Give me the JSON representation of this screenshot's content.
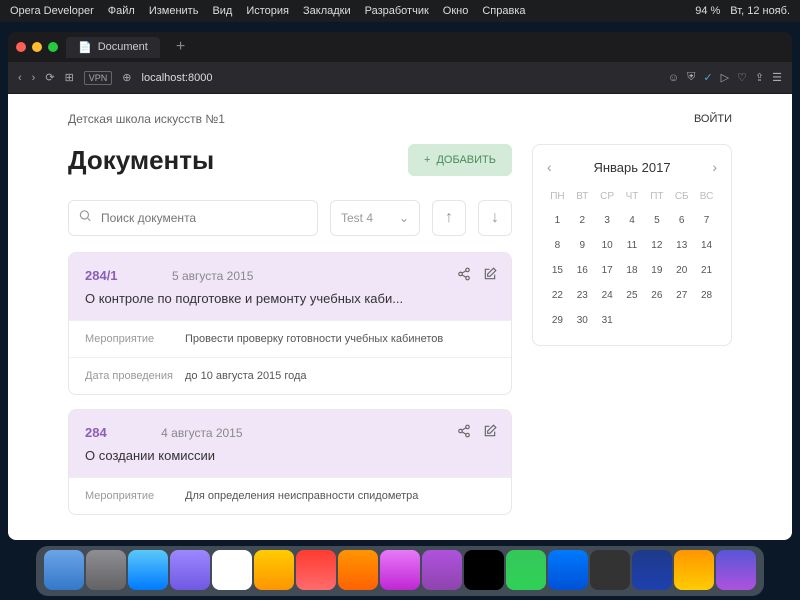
{
  "menubar": {
    "app": "Opera Developer",
    "items": [
      "Файл",
      "Изменить",
      "Вид",
      "История",
      "Закладки",
      "Разработчик",
      "Окно",
      "Справка"
    ],
    "battery": "94 %",
    "clock": "Вт, 12 нояб."
  },
  "browser": {
    "tab_title": "Document",
    "url": "localhost:8000",
    "vpn": "VPN"
  },
  "header": {
    "brand": "Детская школа искусств №1",
    "login": "ВОЙТИ"
  },
  "page_title": "Документы",
  "add_button": "ДОБАВИТЬ",
  "search": {
    "placeholder": "Поиск документа"
  },
  "filter": {
    "selected": "Test 4"
  },
  "documents": [
    {
      "num": "284/1",
      "date": "5 августа 2015",
      "title": "О контроле по подготовке и ремонту учебных каби...",
      "rows": [
        {
          "label": "Мероприятие",
          "value": "Провести проверку готовности учебных кабинетов"
        },
        {
          "label": "Дата проведения",
          "value": "до 10 августа 2015 года"
        }
      ]
    },
    {
      "num": "284",
      "date": "4 августа 2015",
      "title": "О создании комиссии",
      "rows": [
        {
          "label": "Мероприятие",
          "value": "Для определения неисправности спидометра"
        }
      ]
    }
  ],
  "calendar": {
    "month": "Январь 2017",
    "dayheaders": [
      "ПН",
      "ВТ",
      "СР",
      "ЧТ",
      "ПТ",
      "СБ",
      "ВС"
    ],
    "weeks": [
      [
        " ",
        " ",
        " ",
        " ",
        " ",
        " ",
        "1"
      ],
      [
        "2",
        "3",
        "4",
        "5",
        "6",
        "7",
        "8"
      ],
      [
        "9",
        "10",
        "11",
        "12",
        "13",
        "14",
        "15"
      ],
      [
        "16",
        "17",
        "18",
        "19",
        "20",
        "21",
        "22"
      ],
      [
        "23",
        "24",
        "25",
        "26",
        "27",
        "28",
        "29"
      ],
      [
        "30",
        "31",
        " ",
        " ",
        " ",
        " ",
        " "
      ]
    ],
    "days": [
      "1",
      "2",
      "3",
      "4",
      "5",
      "6",
      "7",
      "8",
      "9",
      "10",
      "11",
      "12",
      "13",
      "14",
      "15",
      "16",
      "17",
      "18",
      "19",
      "20",
      "21",
      "22",
      "23",
      "24",
      "25",
      "26",
      "27",
      "28",
      "29",
      "30",
      "31"
    ]
  }
}
